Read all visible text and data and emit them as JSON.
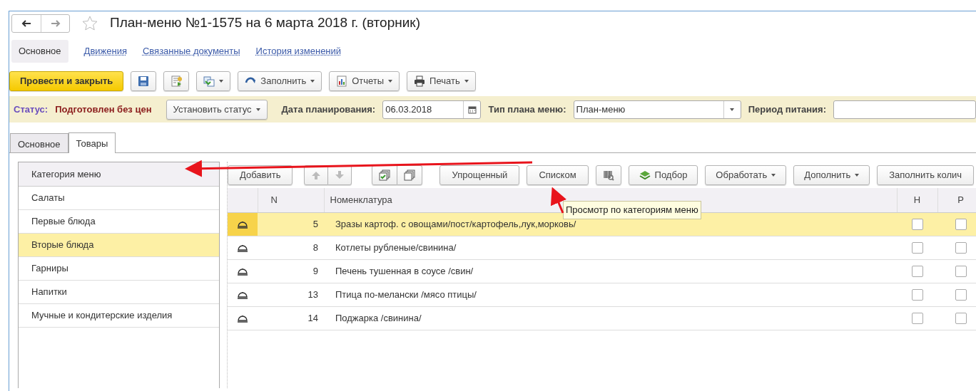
{
  "window": {
    "title": "План-меню №1-1575 на 6 марта 2018 г. (вторник)"
  },
  "nav_links": [
    {
      "label": "Основное",
      "selected": true
    },
    {
      "label": "Движения",
      "selected": false
    },
    {
      "label": "Связанные документы",
      "selected": false
    },
    {
      "label": "История изменений",
      "selected": false
    }
  ],
  "toolbar": [
    {
      "kind": "primary",
      "label": "Провести и закрыть"
    },
    {
      "kind": "icon"
    },
    {
      "kind": "icon"
    },
    {
      "kind": "icon-dropdown"
    },
    {
      "kind": "dropdown",
      "label": "Заполнить"
    },
    {
      "kind": "dropdown",
      "label": "Отчеты"
    },
    {
      "kind": "dropdown",
      "label": "Печать"
    }
  ],
  "status_bar": {
    "status_label": "Статус:",
    "status_value": "Подготовлен без цен",
    "set_status_button": "Установить статус",
    "date_label": "Дата планирования:",
    "date_value": "06.03.2018",
    "plan_type_label": "Тип плана меню:",
    "plan_type_value": "План-меню",
    "period_label": "Период питания:"
  },
  "tabs": [
    {
      "label": "Основное",
      "selected": false
    },
    {
      "label": "Товары",
      "selected": true
    }
  ],
  "categories": {
    "header": "Категория меню",
    "items": [
      {
        "label": "Салаты",
        "selected": false
      },
      {
        "label": "Первые блюда",
        "selected": false
      },
      {
        "label": "Вторые блюда",
        "selected": true
      },
      {
        "label": "Гарниры",
        "selected": false
      },
      {
        "label": "Напитки",
        "selected": false
      },
      {
        "label": "Мучные и кондитерские изделия",
        "selected": false
      }
    ]
  },
  "table_toolbar": [
    {
      "kind": "text",
      "label": "Добавить"
    },
    {
      "kind": "move-group"
    },
    {
      "kind": "copy-group"
    },
    {
      "kind": "text",
      "label": "Упрощенный"
    },
    {
      "kind": "text",
      "label": "Списком"
    },
    {
      "kind": "barcode"
    },
    {
      "kind": "pick",
      "label": "Подбор"
    },
    {
      "kind": "dropdown",
      "label": "Обработать"
    },
    {
      "kind": "dropdown",
      "label": "Дополнить"
    },
    {
      "kind": "text",
      "label": "Заполнить колич"
    }
  ],
  "tooltip": "Просмотр по категориям меню",
  "table": {
    "columns": [
      "N",
      "Номенклатура",
      "Н",
      "Р"
    ],
    "rows": [
      {
        "n": "5",
        "name": "Зразы картоф. с овощами/пост/картофель,лук,морковь/",
        "h": false,
        "p": false,
        "selected": true
      },
      {
        "n": "8",
        "name": "Котлеты рубленые/свинина/",
        "h": false,
        "p": false,
        "selected": false
      },
      {
        "n": "9",
        "name": "Печень тушенная в соусе  /свин/",
        "h": false,
        "p": false,
        "selected": false
      },
      {
        "n": "13",
        "name": "Птица по-мелански /мясо птицы/",
        "h": false,
        "p": false,
        "selected": false
      },
      {
        "n": "14",
        "name": "Поджарка /свинина/",
        "h": false,
        "p": false,
        "selected": false
      }
    ]
  }
}
